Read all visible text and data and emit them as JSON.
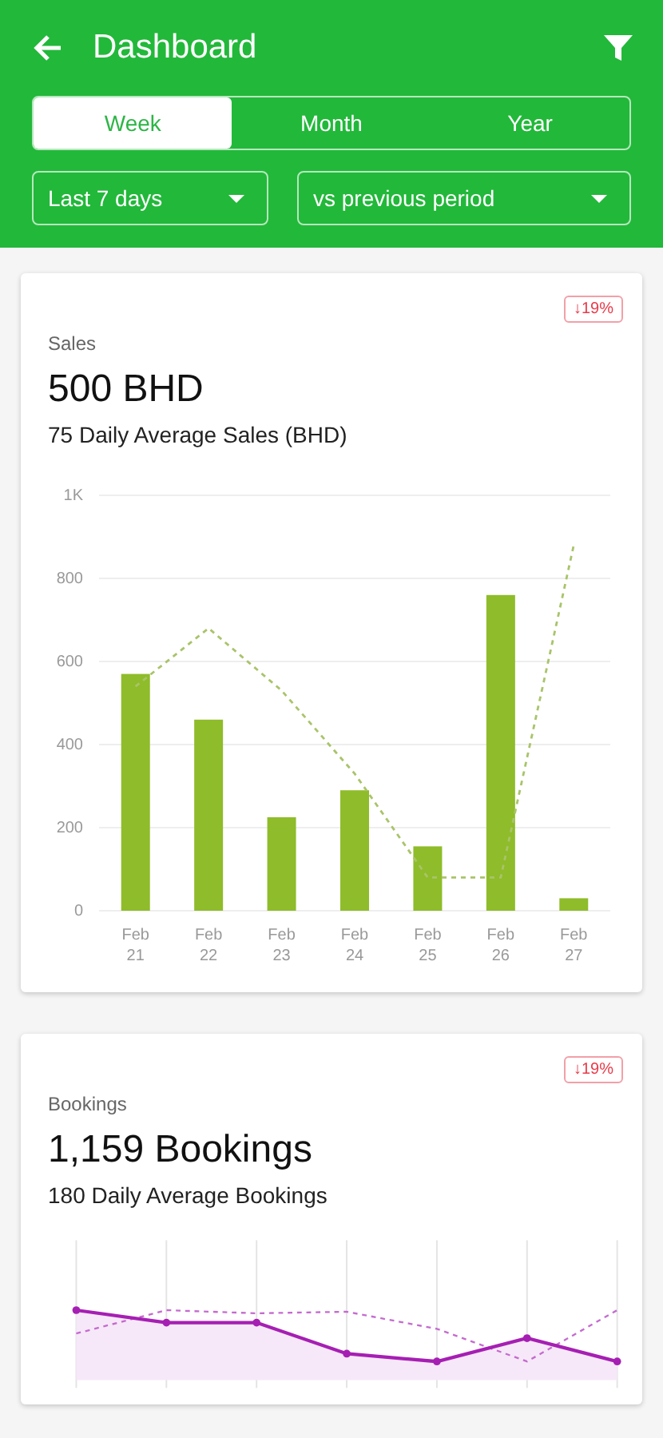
{
  "app_bar": {
    "title": "Dashboard"
  },
  "tabs": [
    {
      "label": "Week",
      "selected": true
    },
    {
      "label": "Month",
      "selected": false
    },
    {
      "label": "Year",
      "selected": false
    }
  ],
  "dropdowns": [
    {
      "value": "Last 7 days"
    },
    {
      "value": "vs previous period"
    }
  ],
  "cards": [
    {
      "kind": "bar",
      "label": "Sales",
      "badge": "↓19%",
      "value": "500 BHD",
      "subtitle": "75 Daily Average Sales (BHD)",
      "chart_data": {
        "type": "bar",
        "stacked": false,
        "grid": true,
        "categories": [
          "Feb\n21",
          "Feb\n22",
          "Feb\n23",
          "Feb\n24",
          "Feb\n25",
          "Feb\n26",
          "Feb\n27"
        ],
        "ylim": [
          0,
          1000
        ],
        "yticks": [
          0,
          200,
          400,
          600,
          800,
          {
            "value": 1000,
            "label": "1K"
          }
        ],
        "series": [
          {
            "color": "#8fbc2a",
            "values": [
              570,
              460,
              225,
              290,
              155,
              760,
              30
            ]
          },
          {
            "type": "line",
            "line_style": "dashed",
            "color": "#a9c46a",
            "values": [
              540,
              680,
              530,
              330,
              80,
              80,
              880
            ]
          }
        ]
      }
    },
    {
      "kind": "line",
      "label": "Bookings",
      "badge": "↓19%",
      "value": "1,159 Bookings",
      "subtitle": "180 Daily Average Bookings"
    }
  ]
}
